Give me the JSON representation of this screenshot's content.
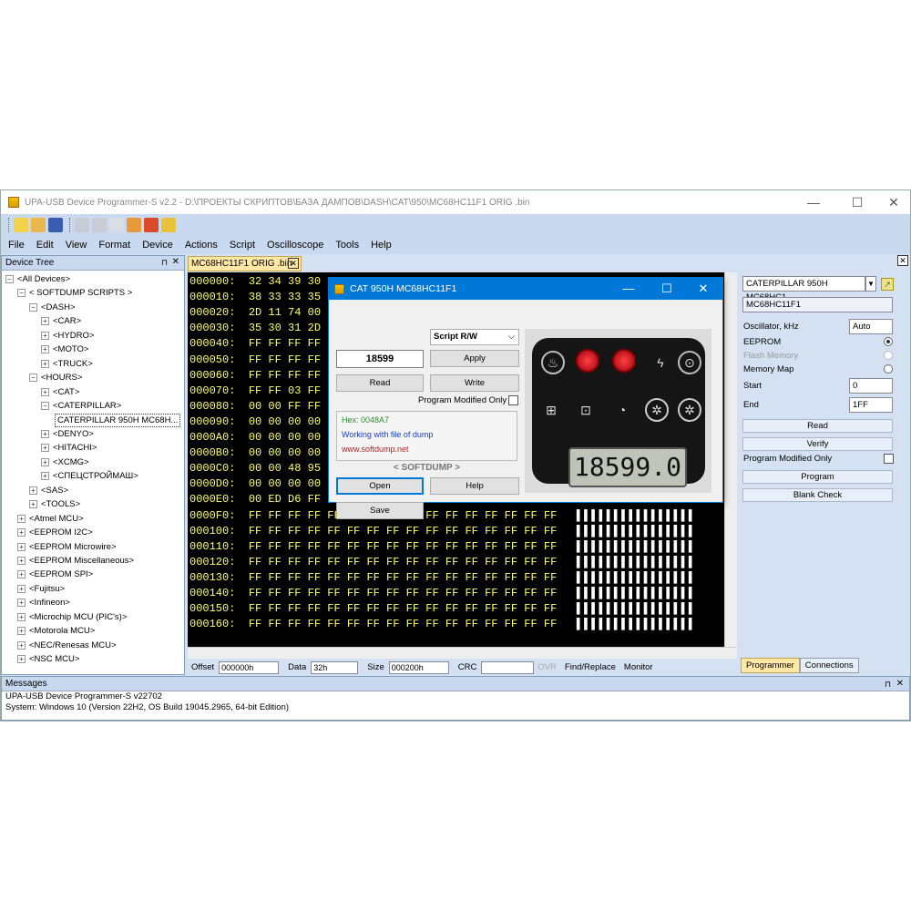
{
  "window": {
    "title": "UPA-USB Device Programmer-S v2.2 - D:\\ПРОЕКТЫ СКРИПТОВ\\БАЗА ДАМПОВ\\DASH\\CAT\\950\\MC68HC11F1 ORIG .bin",
    "min": "—",
    "max": "☐",
    "close": "✕"
  },
  "menu": [
    "File",
    "Edit",
    "View",
    "Format",
    "Device",
    "Actions",
    "Script",
    "Oscilloscope",
    "Tools",
    "Help"
  ],
  "tree": {
    "header": "Device Tree",
    "pin": "⊓",
    "close": "✕",
    "nodes": [
      {
        "label": "<All Devices>",
        "sign": "−",
        "level": 0
      },
      {
        "label": "< SOFTDUMP SCRIPTS >",
        "sign": "−",
        "level": 1
      },
      {
        "label": "<DASH>",
        "sign": "−",
        "level": 2
      },
      {
        "label": "<CAR>",
        "sign": "+",
        "level": 3
      },
      {
        "label": "<HYDRO>",
        "sign": "+",
        "level": 3
      },
      {
        "label": "<MOTO>",
        "sign": "+",
        "level": 3
      },
      {
        "label": "<TRUCK>",
        "sign": "+",
        "level": 3
      },
      {
        "label": "<HOURS>",
        "sign": "−",
        "level": 2
      },
      {
        "label": "<CAT>",
        "sign": "+",
        "level": 3
      },
      {
        "label": "<CATERPILLAR>",
        "sign": "−",
        "level": 3
      },
      {
        "label": "CATERPILLAR 950H MC68H...",
        "sign": "",
        "level": 4
      },
      {
        "label": "<DENYO>",
        "sign": "+",
        "level": 3
      },
      {
        "label": "<HITACHI>",
        "sign": "+",
        "level": 3
      },
      {
        "label": "<XCMG>",
        "sign": "+",
        "level": 3
      },
      {
        "label": "<СПЕЦСТРОЙМАШ>",
        "sign": "+",
        "level": 3
      },
      {
        "label": "<SAS>",
        "sign": "+",
        "level": 2
      },
      {
        "label": "<TOOLS>",
        "sign": "+",
        "level": 2
      },
      {
        "label": "<Atmel MCU>",
        "sign": "+",
        "level": 1
      },
      {
        "label": "<EEPROM I2C>",
        "sign": "+",
        "level": 1
      },
      {
        "label": "<EEPROM Microwire>",
        "sign": "+",
        "level": 1
      },
      {
        "label": "<EEPROM Miscellaneous>",
        "sign": "+",
        "level": 1
      },
      {
        "label": "<EEPROM SPI>",
        "sign": "+",
        "level": 1
      },
      {
        "label": "<Fujitsu>",
        "sign": "+",
        "level": 1
      },
      {
        "label": "<Infineon>",
        "sign": "+",
        "level": 1
      },
      {
        "label": "<Microchip MCU (PIC's)>",
        "sign": "+",
        "level": 1
      },
      {
        "label": "<Motorola MCU>",
        "sign": "+",
        "level": 1
      },
      {
        "label": "<NEC/Renesas MCU>",
        "sign": "+",
        "level": 1
      },
      {
        "label": "<NSC MCU>",
        "sign": "+",
        "level": 1
      }
    ]
  },
  "editor": {
    "tab": "MC68HC11F1 ORIG .bin",
    "tab_close": "✕",
    "rows": [
      {
        "addr": "000000:",
        "bytes": "32 34 39 30",
        "ascii": ""
      },
      {
        "addr": "000010:",
        "bytes": "38 33 33 35",
        "ascii": ""
      },
      {
        "addr": "000020:",
        "bytes": "2D 11 74 00",
        "ascii": ""
      },
      {
        "addr": "000030:",
        "bytes": "35 30 31 2D",
        "ascii": ""
      },
      {
        "addr": "000040:",
        "bytes": "FF FF FF FF",
        "ascii": ""
      },
      {
        "addr": "000050:",
        "bytes": "FF FF FF FF",
        "ascii": ""
      },
      {
        "addr": "000060:",
        "bytes": "FF FF FF FF",
        "ascii": ""
      },
      {
        "addr": "000070:",
        "bytes": "FF FF 03 FF",
        "ascii": ""
      },
      {
        "addr": "000080:",
        "bytes": "00 00 FF FF",
        "ascii": ""
      },
      {
        "addr": "000090:",
        "bytes": "00 00 00 00",
        "ascii": ""
      },
      {
        "addr": "0000A0:",
        "bytes": "00 00 00 00",
        "ascii": ""
      },
      {
        "addr": "0000B0:",
        "bytes": "00 00 00 00",
        "ascii": ""
      },
      {
        "addr": "0000C0:",
        "bytes": "00 00 48 95",
        "ascii": ""
      },
      {
        "addr": "0000D0:",
        "bytes": "00 00 00 00",
        "ascii": ""
      },
      {
        "addr": "0000E0:",
        "bytes": "00 ED D6 FF",
        "ascii": ""
      },
      {
        "addr": "0000F0:",
        "bytes": "FF FF FF FF FF FF FF FF FF FF FF FF FF FF FF FF",
        "ascii": "▌▌▌▌▌▌▌▌▌▌▌▌▌▌▌▌"
      },
      {
        "addr": "000100:",
        "bytes": "FF FF FF FF FF FF FF FF FF FF FF FF FF FF FF FF",
        "ascii": "▌▌▌▌▌▌▌▌▌▌▌▌▌▌▌▌"
      },
      {
        "addr": "000110:",
        "bytes": "FF FF FF FF FF FF FF FF FF FF FF FF FF FF FF FF",
        "ascii": "▌▌▌▌▌▌▌▌▌▌▌▌▌▌▌▌"
      },
      {
        "addr": "000120:",
        "bytes": "FF FF FF FF FF FF FF FF FF FF FF FF FF FF FF FF",
        "ascii": "▌▌▌▌▌▌▌▌▌▌▌▌▌▌▌▌"
      },
      {
        "addr": "000130:",
        "bytes": "FF FF FF FF FF FF FF FF FF FF FF FF FF FF FF FF",
        "ascii": "▌▌▌▌▌▌▌▌▌▌▌▌▌▌▌▌"
      },
      {
        "addr": "000140:",
        "bytes": "FF FF FF FF FF FF FF FF FF FF FF FF FF FF FF FF",
        "ascii": "▌▌▌▌▌▌▌▌▌▌▌▌▌▌▌▌"
      },
      {
        "addr": "000150:",
        "bytes": "FF FF FF FF FF FF FF FF FF FF FF FF FF FF FF FF",
        "ascii": "▌▌▌▌▌▌▌▌▌▌▌▌▌▌▌▌"
      },
      {
        "addr": "000160:",
        "bytes": "FF FF FF FF FF FF FF FF FF FF FF FF FF FF FF FF",
        "ascii": "▌▌▌▌▌▌▌▌▌▌▌▌▌▌▌▌"
      }
    ]
  },
  "status": {
    "offset_label": "Offset",
    "offset": "000000h",
    "data_label": "Data",
    "data": "32h",
    "size_label": "Size",
    "size": "000200h",
    "crc_label": "CRC",
    "crc": "",
    "ovr": "OVR",
    "find": "Find/Replace",
    "monitor": "Monitor"
  },
  "programmer": {
    "device": "CATERPILLAR 950H MC68HC1",
    "chip": "MC68HC11F1",
    "osc_label": "Oscillator, kHz",
    "osc_value": "Auto",
    "eeprom": "EEPROM",
    "flash": "Flash Memory",
    "memmap": "Memory Map",
    "start_label": "Start",
    "start": "0",
    "end_label": "End",
    "end": "1FF",
    "buttons": [
      "Read",
      "Verify",
      "Program Modified Only",
      "Program",
      "Blank Check"
    ],
    "tabs": [
      "Programmer",
      "Connections"
    ]
  },
  "messages": {
    "header": "Messages",
    "lines": [
      "UPA-USB Device Programmer-S v22702",
      "System: Windows 10 (Version 22H2, OS Build 19045.2965, 64-bit Edition)"
    ]
  },
  "dialog": {
    "title": "CAT 950H MC68HC11F1",
    "script_mode": "Script R/W",
    "hours": "18599",
    "apply": "Apply",
    "read": "Read",
    "write": "Write",
    "modified_only": "Program Modified Only",
    "hex": "Hex: 0048A7",
    "working": "Working with file of dump",
    "site": "www.softdump.net",
    "brand": "< SOFTDUMP >",
    "open": "Open",
    "help": "Help",
    "save": "Save",
    "lcd": "18599.0",
    "colors": {
      "hex": "#2e8b2e",
      "working": "#1a3fbf",
      "site": "#b22222"
    }
  }
}
